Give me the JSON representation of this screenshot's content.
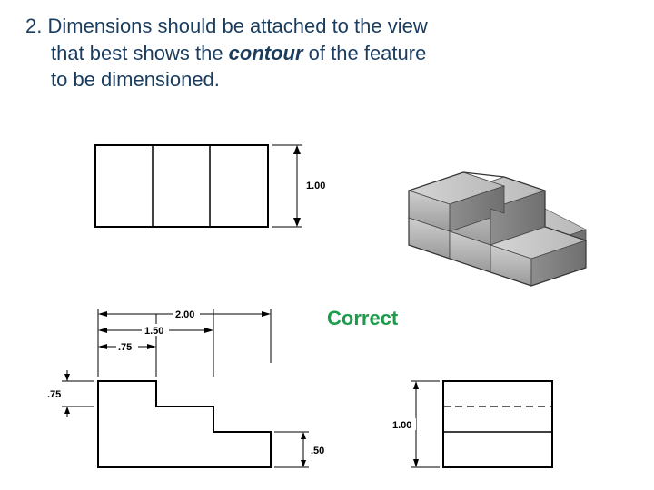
{
  "rule": {
    "number": "2.",
    "line1_prefix": "Dimensions should be attached to the view",
    "line2": "that best shows the ",
    "contour_word": "contour",
    "line2_suffix": " of the feature",
    "line3": "to be dimensioned."
  },
  "correct_label": "Correct",
  "dimensions": {
    "top_height": "1.00",
    "width_full": "2.00",
    "width_mid": "1.50",
    "width_small": ".75",
    "step_height": ".75",
    "notch_height": ".50",
    "side_height": "1.00"
  }
}
